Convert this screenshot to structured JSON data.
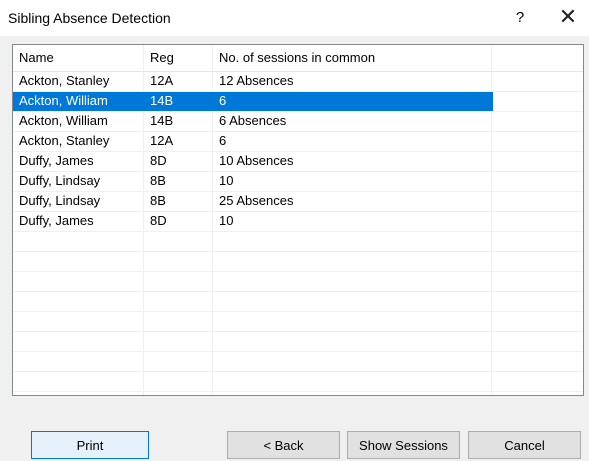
{
  "window": {
    "title": "Sibling Absence Detection",
    "help_label": "?",
    "close_label": "✕"
  },
  "table": {
    "columns": [
      "Name",
      "Reg",
      "No. of sessions in common"
    ],
    "selected_index": 1,
    "rows": [
      {
        "name": "Ackton, Stanley",
        "reg": "12A",
        "sessions": "12 Absences"
      },
      {
        "name": "Ackton, William",
        "reg": "14B",
        "sessions": "6"
      },
      {
        "name": "Ackton, William",
        "reg": "14B",
        "sessions": "6 Absences"
      },
      {
        "name": "Ackton, Stanley",
        "reg": "12A",
        "sessions": "6"
      },
      {
        "name": "Duffy, James",
        "reg": "8D",
        "sessions": "10 Absences"
      },
      {
        "name": "Duffy, Lindsay",
        "reg": "8B",
        "sessions": "10"
      },
      {
        "name": "Duffy, Lindsay",
        "reg": "8B",
        "sessions": "25 Absences"
      },
      {
        "name": "Duffy, James",
        "reg": "8D",
        "sessions": "10"
      }
    ]
  },
  "buttons": {
    "print": "Print",
    "back": "< Back",
    "show_sessions": "Show Sessions",
    "cancel": "Cancel"
  },
  "colors": {
    "selection": "#0078d7",
    "window_bg": "#f0f0f0"
  }
}
